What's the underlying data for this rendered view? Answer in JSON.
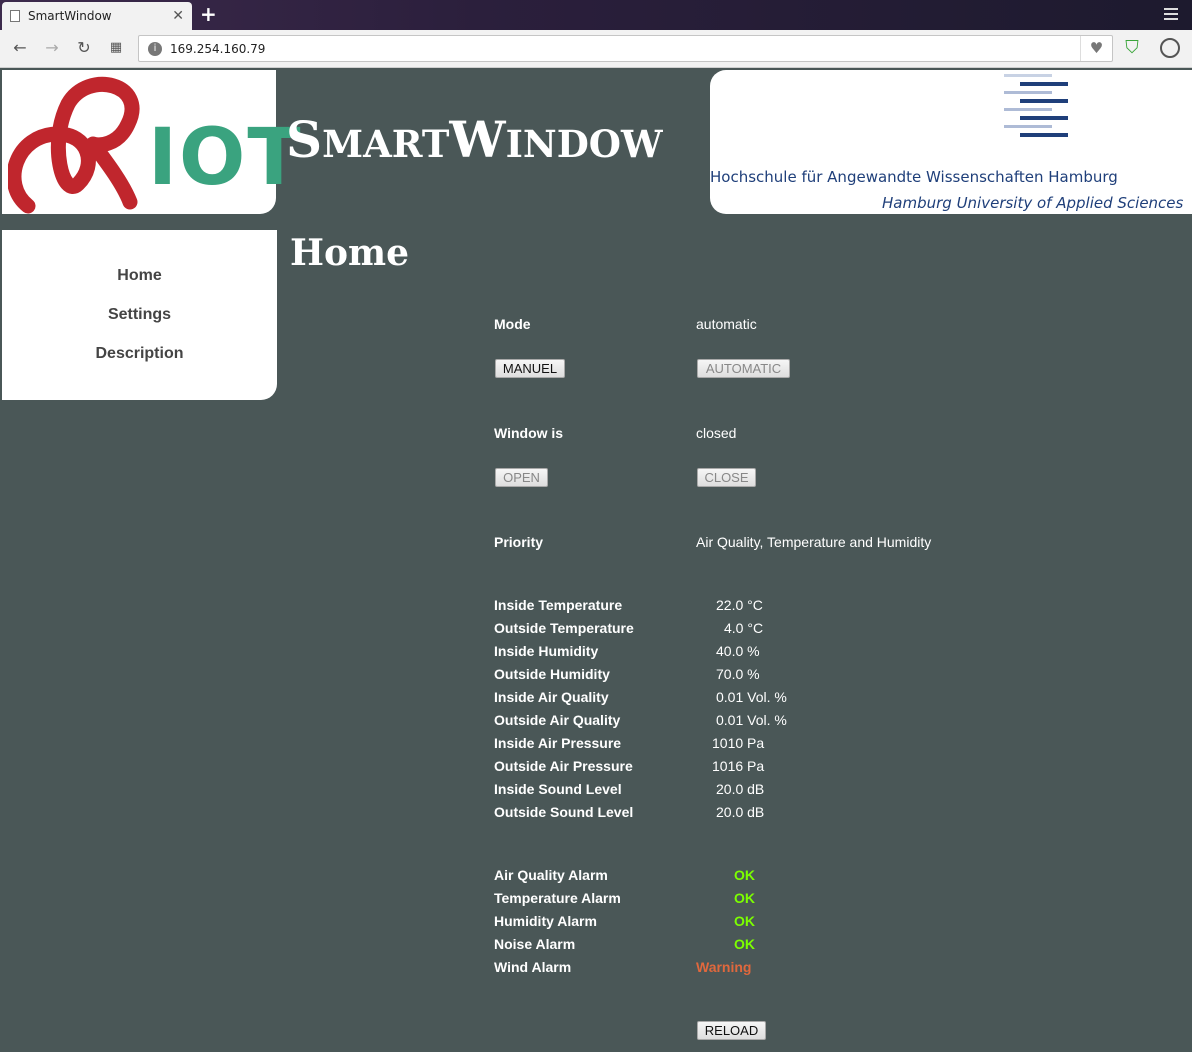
{
  "browser": {
    "tab_title": "SmartWindow",
    "url": "169.254.160.79"
  },
  "header": {
    "logo_left_text": "IOT",
    "title_first": "S",
    "title_first_rest": "MART",
    "title_second": "W",
    "title_second_rest": "INDOW",
    "logo_right_de": "Hochschule für Angewandte Wissenschaften Hamburg",
    "logo_right_en": "Hamburg University of Applied Sciences"
  },
  "sidebar": {
    "items": [
      {
        "label": "Home"
      },
      {
        "label": "Settings"
      },
      {
        "label": "Description"
      }
    ]
  },
  "main": {
    "page_title": "Home",
    "mode": {
      "label": "Mode",
      "value": "automatic",
      "manual_button": "MANUEL",
      "automatic_button": "AUTOMATIC"
    },
    "window": {
      "label": "Window is",
      "value": "closed",
      "open_button": "OPEN",
      "close_button": "CLOSE"
    },
    "priority": {
      "label": "Priority",
      "value": "Air Quality, Temperature and Humidity"
    },
    "sensors": [
      {
        "label": "Inside Temperature",
        "value": "22.0 °C"
      },
      {
        "label": "Outside Temperature",
        "value": "4.0 °C"
      },
      {
        "label": "Inside Humidity",
        "value": "40.0 %"
      },
      {
        "label": "Outside Humidity",
        "value": "70.0 %"
      },
      {
        "label": "Inside Air Quality",
        "value": "0.01 Vol. %"
      },
      {
        "label": "Outside Air Quality",
        "value": "0.01 Vol. %"
      },
      {
        "label": "Inside Air Pressure",
        "value": "1010 Pa"
      },
      {
        "label": "Outside Air Pressure",
        "value": "1016 Pa"
      },
      {
        "label": "Inside Sound Level",
        "value": "20.0 dB"
      },
      {
        "label": "Outside Sound Level",
        "value": "20.0 dB"
      }
    ],
    "alarms": [
      {
        "label": "Air Quality Alarm",
        "value": "OK"
      },
      {
        "label": "Temperature Alarm",
        "value": "OK"
      },
      {
        "label": "Humidity Alarm",
        "value": "OK"
      },
      {
        "label": "Noise Alarm",
        "value": "OK"
      },
      {
        "label": "Wind Alarm",
        "value": "Warning"
      }
    ],
    "reload_button": "RELOAD"
  },
  "colors": {
    "page_background": "#4a5757",
    "ok": "#7cff00",
    "warning": "#e0683d",
    "riot_red": "#c0262d",
    "riot_green": "#3aa37f",
    "haw_blue": "#1f3f7a"
  }
}
